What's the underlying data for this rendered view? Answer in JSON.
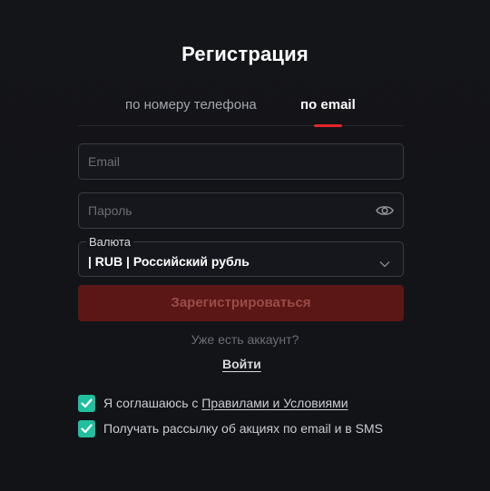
{
  "form": {
    "title": "Регистрация",
    "tabs": [
      {
        "label": "по номеру телефона",
        "active": false
      },
      {
        "label": "по email",
        "active": true
      }
    ],
    "email": {
      "placeholder": "Email",
      "value": ""
    },
    "password": {
      "placeholder": "Пароль",
      "value": "",
      "toggle_icon": "eye-icon"
    },
    "currency": {
      "label": "Валюта",
      "selected": "| RUB | Российский рубль",
      "dropdown_icon": "chevron-down-icon"
    },
    "register_label": "Зарегистрироваться",
    "have_account_text": "Уже есть аккаунт?",
    "login_label": "Войти",
    "agreements": [
      {
        "checked": true,
        "text_prefix": "Я соглашаюсь с ",
        "link_text": "Правилами и Условиями"
      },
      {
        "checked": true,
        "text": "Получать рассылку об акциях по email и в SMS"
      }
    ]
  },
  "colors": {
    "background": "#121317",
    "accent_red": "#e3272c",
    "button_disabled_bg": "#5b1715",
    "button_disabled_text": "#9b4c47",
    "checkbox": "#1fbf9f",
    "field_border": "#393c44"
  }
}
